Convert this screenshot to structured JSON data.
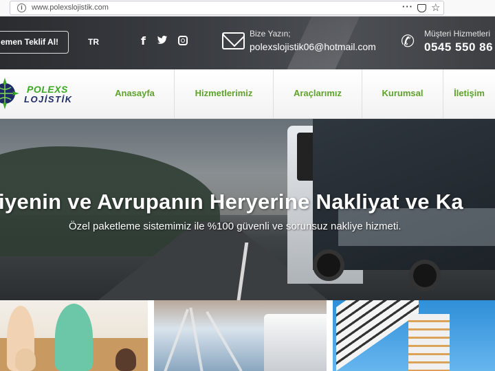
{
  "browser": {
    "url": "www.polexslojistik.com",
    "info_icon": "info-icon",
    "menu_icon": "more-dots-icon",
    "pocket_icon": "pocket-icon",
    "bookmark_icon": "star-icon"
  },
  "topbar": {
    "quote_button": "emen Teklif Al!",
    "language": "TR",
    "social_icons": [
      "facebook-icon",
      "twitter-icon",
      "instagram-icon"
    ],
    "mail_label": "Bize Yazın;",
    "mail_value": "polexslojistik06@hotmail.com",
    "phone_label": "Müşteri Hizmetleri",
    "phone_value": "0545 550 86"
  },
  "logo": {
    "line1": "POLEXS",
    "line2": "LOJİSTİK"
  },
  "nav": {
    "items": [
      {
        "label": "Anasayfa"
      },
      {
        "label": "Hizmetlerimiz"
      },
      {
        "label": "Araçlarımız"
      },
      {
        "label": "Kurumsal"
      },
      {
        "label": "İletişim"
      }
    ]
  },
  "hero": {
    "title": "iyenin ve Avrupanın Heryerine Nakliyat ve Ka",
    "subtitle": "Özel paketleme sistemimiz ile %100 güvenli ve sorunsuz nakliye hizmeti."
  },
  "colors": {
    "nav_text": "#5da32b",
    "logo_green": "#3aa81f",
    "logo_navy": "#1d2a66",
    "topbar_bg": "#3a3d42"
  }
}
